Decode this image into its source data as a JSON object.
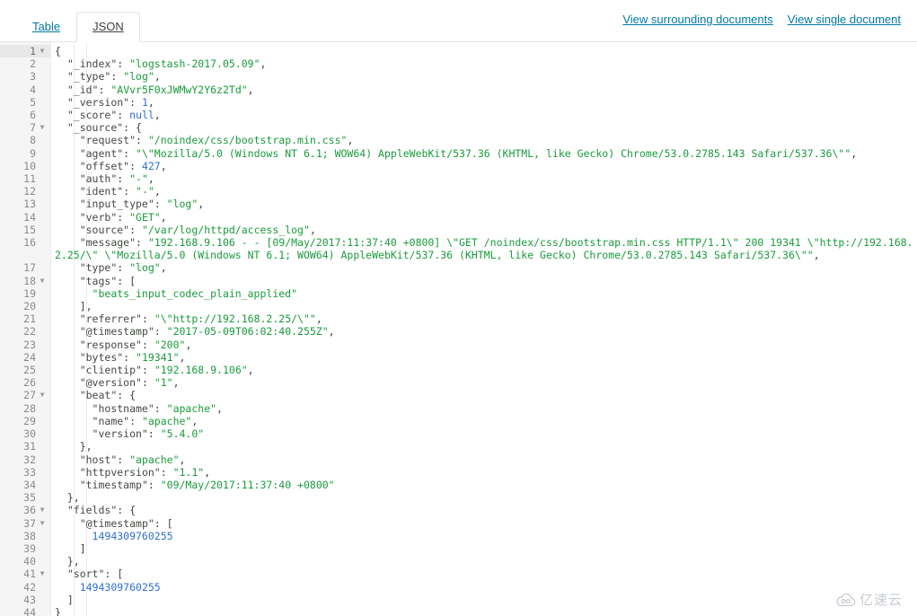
{
  "tabs": [
    {
      "label": "Table",
      "active": false
    },
    {
      "label": "JSON",
      "active": true
    }
  ],
  "header": {
    "links": [
      "View surrounding documents",
      "View single document"
    ]
  },
  "colors": {
    "link": "#0079a5",
    "key": "#434a42",
    "string": "#1a9b3d",
    "number": "#2f6fd0",
    "gutter_bg": "#f5f5f5",
    "active_line_bg": "#e8e8e8"
  },
  "editor": {
    "total_lines": 44,
    "active_line": 1,
    "fold_markers": [
      1,
      7,
      18,
      27,
      36,
      37,
      41
    ],
    "lines": [
      {
        "num": 1,
        "indent": 0,
        "tokens": [
          {
            "t": "p",
            "v": "{"
          }
        ]
      },
      {
        "num": 2,
        "indent": 1,
        "tokens": [
          {
            "t": "k",
            "v": "\"_index\""
          },
          {
            "t": "p",
            "v": ": "
          },
          {
            "t": "s",
            "v": "\"logstash-2017.05.09\""
          },
          {
            "t": "p",
            "v": ","
          }
        ]
      },
      {
        "num": 3,
        "indent": 1,
        "tokens": [
          {
            "t": "k",
            "v": "\"_type\""
          },
          {
            "t": "p",
            "v": ": "
          },
          {
            "t": "s",
            "v": "\"log\""
          },
          {
            "t": "p",
            "v": ","
          }
        ]
      },
      {
        "num": 4,
        "indent": 1,
        "tokens": [
          {
            "t": "k",
            "v": "\"_id\""
          },
          {
            "t": "p",
            "v": ": "
          },
          {
            "t": "s",
            "v": "\"AVvr5F0xJWMwY2Y6z2Td\""
          },
          {
            "t": "p",
            "v": ","
          }
        ]
      },
      {
        "num": 5,
        "indent": 1,
        "tokens": [
          {
            "t": "k",
            "v": "\"_version\""
          },
          {
            "t": "p",
            "v": ": "
          },
          {
            "t": "n",
            "v": "1"
          },
          {
            "t": "p",
            "v": ","
          }
        ]
      },
      {
        "num": 6,
        "indent": 1,
        "tokens": [
          {
            "t": "k",
            "v": "\"_score\""
          },
          {
            "t": "p",
            "v": ": "
          },
          {
            "t": "n",
            "v": "null"
          },
          {
            "t": "p",
            "v": ","
          }
        ]
      },
      {
        "num": 7,
        "indent": 1,
        "tokens": [
          {
            "t": "k",
            "v": "\"_source\""
          },
          {
            "t": "p",
            "v": ": {"
          }
        ]
      },
      {
        "num": 8,
        "indent": 2,
        "tokens": [
          {
            "t": "k",
            "v": "\"request\""
          },
          {
            "t": "p",
            "v": ": "
          },
          {
            "t": "s",
            "v": "\"/noindex/css/bootstrap.min.css\""
          },
          {
            "t": "p",
            "v": ","
          }
        ]
      },
      {
        "num": 9,
        "indent": 2,
        "tokens": [
          {
            "t": "k",
            "v": "\"agent\""
          },
          {
            "t": "p",
            "v": ": "
          },
          {
            "t": "s",
            "v": "\"\\\"Mozilla/5.0 (Windows NT 6.1; WOW64) AppleWebKit/537.36 (KHTML, like Gecko) Chrome/53.0.2785.143 Safari/537.36\\\"\""
          },
          {
            "t": "p",
            "v": ","
          }
        ]
      },
      {
        "num": 10,
        "indent": 2,
        "tokens": [
          {
            "t": "k",
            "v": "\"offset\""
          },
          {
            "t": "p",
            "v": ": "
          },
          {
            "t": "n",
            "v": "427"
          },
          {
            "t": "p",
            "v": ","
          }
        ]
      },
      {
        "num": 11,
        "indent": 2,
        "tokens": [
          {
            "t": "k",
            "v": "\"auth\""
          },
          {
            "t": "p",
            "v": ": "
          },
          {
            "t": "s",
            "v": "\"-\""
          },
          {
            "t": "p",
            "v": ","
          }
        ]
      },
      {
        "num": 12,
        "indent": 2,
        "tokens": [
          {
            "t": "k",
            "v": "\"ident\""
          },
          {
            "t": "p",
            "v": ": "
          },
          {
            "t": "s",
            "v": "\"-\""
          },
          {
            "t": "p",
            "v": ","
          }
        ]
      },
      {
        "num": 13,
        "indent": 2,
        "tokens": [
          {
            "t": "k",
            "v": "\"input_type\""
          },
          {
            "t": "p",
            "v": ": "
          },
          {
            "t": "s",
            "v": "\"log\""
          },
          {
            "t": "p",
            "v": ","
          }
        ]
      },
      {
        "num": 14,
        "indent": 2,
        "tokens": [
          {
            "t": "k",
            "v": "\"verb\""
          },
          {
            "t": "p",
            "v": ": "
          },
          {
            "t": "s",
            "v": "\"GET\""
          },
          {
            "t": "p",
            "v": ","
          }
        ]
      },
      {
        "num": 15,
        "indent": 2,
        "tokens": [
          {
            "t": "k",
            "v": "\"source\""
          },
          {
            "t": "p",
            "v": ": "
          },
          {
            "t": "s",
            "v": "\"/var/log/httpd/access_log\""
          },
          {
            "t": "p",
            "v": ","
          }
        ]
      },
      {
        "num": 16,
        "indent": 2,
        "tokens": [
          {
            "t": "k",
            "v": "\"message\""
          },
          {
            "t": "p",
            "v": ": "
          },
          {
            "t": "s",
            "v": "\"192.168.9.106 - - [09/May/2017:11:37:40 +0800] \\\"GET /noindex/css/bootstrap.min.css HTTP/1.1\\\" 200 19341 \\\"http://192.168.2.25/\\\" \\\"Mozilla/5.0 (Windows NT 6.1; WOW64) AppleWebKit/537.36 (KHTML, like Gecko) Chrome/53.0.2785.143 Safari/537.36\\\"\""
          },
          {
            "t": "p",
            "v": ","
          }
        ]
      },
      {
        "num": 17,
        "indent": 2,
        "tokens": [
          {
            "t": "k",
            "v": "\"type\""
          },
          {
            "t": "p",
            "v": ": "
          },
          {
            "t": "s",
            "v": "\"log\""
          },
          {
            "t": "p",
            "v": ","
          }
        ]
      },
      {
        "num": 18,
        "indent": 2,
        "tokens": [
          {
            "t": "k",
            "v": "\"tags\""
          },
          {
            "t": "p",
            "v": ": ["
          }
        ]
      },
      {
        "num": 19,
        "indent": 3,
        "tokens": [
          {
            "t": "s",
            "v": "\"beats_input_codec_plain_applied\""
          }
        ]
      },
      {
        "num": 20,
        "indent": 2,
        "tokens": [
          {
            "t": "p",
            "v": "],"
          }
        ]
      },
      {
        "num": 21,
        "indent": 2,
        "tokens": [
          {
            "t": "k",
            "v": "\"referrer\""
          },
          {
            "t": "p",
            "v": ": "
          },
          {
            "t": "s",
            "v": "\"\\\"http://192.168.2.25/\\\"\""
          },
          {
            "t": "p",
            "v": ","
          }
        ]
      },
      {
        "num": 22,
        "indent": 2,
        "tokens": [
          {
            "t": "k",
            "v": "\"@timestamp\""
          },
          {
            "t": "p",
            "v": ": "
          },
          {
            "t": "s",
            "v": "\"2017-05-09T06:02:40.255Z\""
          },
          {
            "t": "p",
            "v": ","
          }
        ]
      },
      {
        "num": 23,
        "indent": 2,
        "tokens": [
          {
            "t": "k",
            "v": "\"response\""
          },
          {
            "t": "p",
            "v": ": "
          },
          {
            "t": "s",
            "v": "\"200\""
          },
          {
            "t": "p",
            "v": ","
          }
        ]
      },
      {
        "num": 24,
        "indent": 2,
        "tokens": [
          {
            "t": "k",
            "v": "\"bytes\""
          },
          {
            "t": "p",
            "v": ": "
          },
          {
            "t": "s",
            "v": "\"19341\""
          },
          {
            "t": "p",
            "v": ","
          }
        ]
      },
      {
        "num": 25,
        "indent": 2,
        "tokens": [
          {
            "t": "k",
            "v": "\"clientip\""
          },
          {
            "t": "p",
            "v": ": "
          },
          {
            "t": "s",
            "v": "\"192.168.9.106\""
          },
          {
            "t": "p",
            "v": ","
          }
        ]
      },
      {
        "num": 26,
        "indent": 2,
        "tokens": [
          {
            "t": "k",
            "v": "\"@version\""
          },
          {
            "t": "p",
            "v": ": "
          },
          {
            "t": "s",
            "v": "\"1\""
          },
          {
            "t": "p",
            "v": ","
          }
        ]
      },
      {
        "num": 27,
        "indent": 2,
        "tokens": [
          {
            "t": "k",
            "v": "\"beat\""
          },
          {
            "t": "p",
            "v": ": {"
          }
        ]
      },
      {
        "num": 28,
        "indent": 3,
        "tokens": [
          {
            "t": "k",
            "v": "\"hostname\""
          },
          {
            "t": "p",
            "v": ": "
          },
          {
            "t": "s",
            "v": "\"apache\""
          },
          {
            "t": "p",
            "v": ","
          }
        ]
      },
      {
        "num": 29,
        "indent": 3,
        "tokens": [
          {
            "t": "k",
            "v": "\"name\""
          },
          {
            "t": "p",
            "v": ": "
          },
          {
            "t": "s",
            "v": "\"apache\""
          },
          {
            "t": "p",
            "v": ","
          }
        ]
      },
      {
        "num": 30,
        "indent": 3,
        "tokens": [
          {
            "t": "k",
            "v": "\"version\""
          },
          {
            "t": "p",
            "v": ": "
          },
          {
            "t": "s",
            "v": "\"5.4.0\""
          }
        ]
      },
      {
        "num": 31,
        "indent": 2,
        "tokens": [
          {
            "t": "p",
            "v": "},"
          }
        ]
      },
      {
        "num": 32,
        "indent": 2,
        "tokens": [
          {
            "t": "k",
            "v": "\"host\""
          },
          {
            "t": "p",
            "v": ": "
          },
          {
            "t": "s",
            "v": "\"apache\""
          },
          {
            "t": "p",
            "v": ","
          }
        ]
      },
      {
        "num": 33,
        "indent": 2,
        "tokens": [
          {
            "t": "k",
            "v": "\"httpversion\""
          },
          {
            "t": "p",
            "v": ": "
          },
          {
            "t": "s",
            "v": "\"1.1\""
          },
          {
            "t": "p",
            "v": ","
          }
        ]
      },
      {
        "num": 34,
        "indent": 2,
        "tokens": [
          {
            "t": "k",
            "v": "\"timestamp\""
          },
          {
            "t": "p",
            "v": ": "
          },
          {
            "t": "s",
            "v": "\"09/May/2017:11:37:40 +0800\""
          }
        ]
      },
      {
        "num": 35,
        "indent": 1,
        "tokens": [
          {
            "t": "p",
            "v": "},"
          }
        ]
      },
      {
        "num": 36,
        "indent": 1,
        "tokens": [
          {
            "t": "k",
            "v": "\"fields\""
          },
          {
            "t": "p",
            "v": ": {"
          }
        ]
      },
      {
        "num": 37,
        "indent": 2,
        "tokens": [
          {
            "t": "k",
            "v": "\"@timestamp\""
          },
          {
            "t": "p",
            "v": ": ["
          }
        ]
      },
      {
        "num": 38,
        "indent": 3,
        "tokens": [
          {
            "t": "n",
            "v": "1494309760255"
          }
        ]
      },
      {
        "num": 39,
        "indent": 2,
        "tokens": [
          {
            "t": "p",
            "v": "]"
          }
        ]
      },
      {
        "num": 40,
        "indent": 1,
        "tokens": [
          {
            "t": "p",
            "v": "},"
          }
        ]
      },
      {
        "num": 41,
        "indent": 1,
        "tokens": [
          {
            "t": "k",
            "v": "\"sort\""
          },
          {
            "t": "p",
            "v": ": ["
          }
        ]
      },
      {
        "num": 42,
        "indent": 2,
        "tokens": [
          {
            "t": "n",
            "v": "1494309760255"
          }
        ]
      },
      {
        "num": 43,
        "indent": 1,
        "tokens": [
          {
            "t": "p",
            "v": "]"
          }
        ]
      },
      {
        "num": 44,
        "indent": 0,
        "tokens": [
          {
            "t": "p",
            "v": "}"
          }
        ]
      }
    ]
  },
  "watermark": {
    "text": "亿速云",
    "icon": "cloud-icon"
  }
}
